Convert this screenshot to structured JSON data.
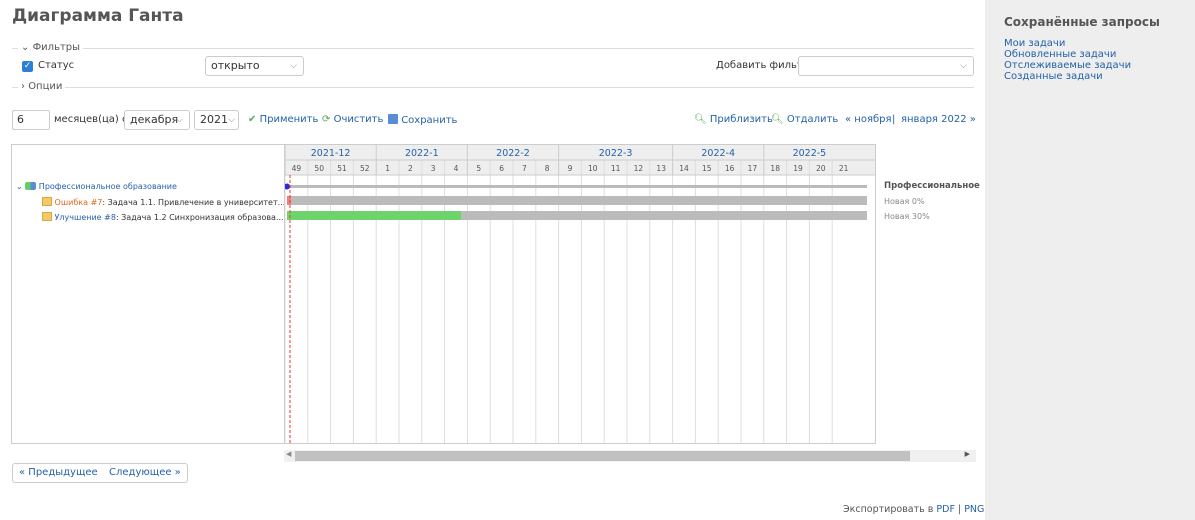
{
  "title": "Диаграмма Ганта",
  "filters": {
    "legend": "Фильтры",
    "status_label": "Статус",
    "status_value": "открыто",
    "add_filter_label": "Добавить фильтр",
    "add_filter_value": ""
  },
  "options": {
    "legend": "Опции"
  },
  "toolbar": {
    "months_value": "6",
    "months_label": "месяцев(ца) с",
    "month_value": "декабря",
    "year_value": "2021",
    "apply": "Применить",
    "clear": "Очистить",
    "save": "Сохранить",
    "zoom_in": "Приблизить",
    "zoom_out": "Отдалить",
    "prev_period": "« ноября",
    "separator": "|",
    "next_period": "января 2022 »"
  },
  "gantt": {
    "months": [
      "2021-12",
      "2022-1",
      "2022-2",
      "2022-3",
      "2022-4",
      "2022-5"
    ],
    "weeks": [
      "49",
      "50",
      "51",
      "52",
      "1",
      "2",
      "3",
      "4",
      "5",
      "6",
      "7",
      "8",
      "9",
      "10",
      "11",
      "12",
      "13",
      "14",
      "15",
      "16",
      "17",
      "18",
      "19",
      "20",
      "21"
    ],
    "project": {
      "name": "Профессиональное образование",
      "label": "Профессиональное"
    },
    "issues": [
      {
        "tracker": "Ошибка #7",
        "subject": ": Задача 1.1. Привлечение в университет...",
        "status": "Новая 0%",
        "progress": 0,
        "tracker_color": "#e2651d"
      },
      {
        "tracker": "Улучшение #8",
        "subject": ": Задача 1.2 Синхронизация образова...",
        "status": "Новая 30%",
        "progress": 30,
        "tracker_color": "#2461a8"
      }
    ]
  },
  "pagination": {
    "previous": "« Предыдущее",
    "next": "Следующее »"
  },
  "export": {
    "label": "Экспортировать в",
    "pdf": "PDF",
    "separator": "|",
    "png": "PNG"
  },
  "sidebar": {
    "title": "Сохранённые запросы",
    "items": [
      "Мои задачи",
      "Обновленные задачи",
      "Отслеживаемые задачи",
      "Созданные задачи"
    ]
  },
  "colors": {
    "link": "#2461a8",
    "bar_done": "#6dd36d",
    "bar_todo": "#bbbbbb",
    "bar_late": "#f08080",
    "today_line": "#e33"
  }
}
